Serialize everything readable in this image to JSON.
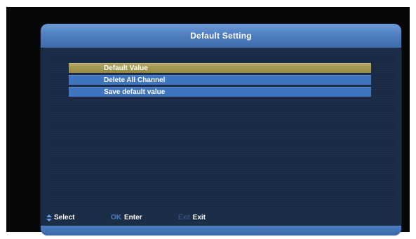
{
  "dialog": {
    "title": "Default Setting"
  },
  "menu": {
    "items": [
      {
        "label": "Default Value",
        "selected": true
      },
      {
        "label": "Delete All Channel",
        "selected": false
      },
      {
        "label": "Save default value",
        "selected": false
      }
    ]
  },
  "footer": {
    "select": {
      "icon": "up-down-arrows-icon",
      "label": "Select"
    },
    "enter": {
      "key": "OK",
      "label": "Enter"
    },
    "exit": {
      "key": "Exit",
      "label": "Exit"
    }
  },
  "colors": {
    "title_bar": "#4f7fc2",
    "menu_item": "#3f74be",
    "menu_item_selected": "#a39853",
    "ok_key": "#4f7fc2",
    "exit_key": "#3a5f99",
    "up_down_icon": "#6aa0e6"
  }
}
